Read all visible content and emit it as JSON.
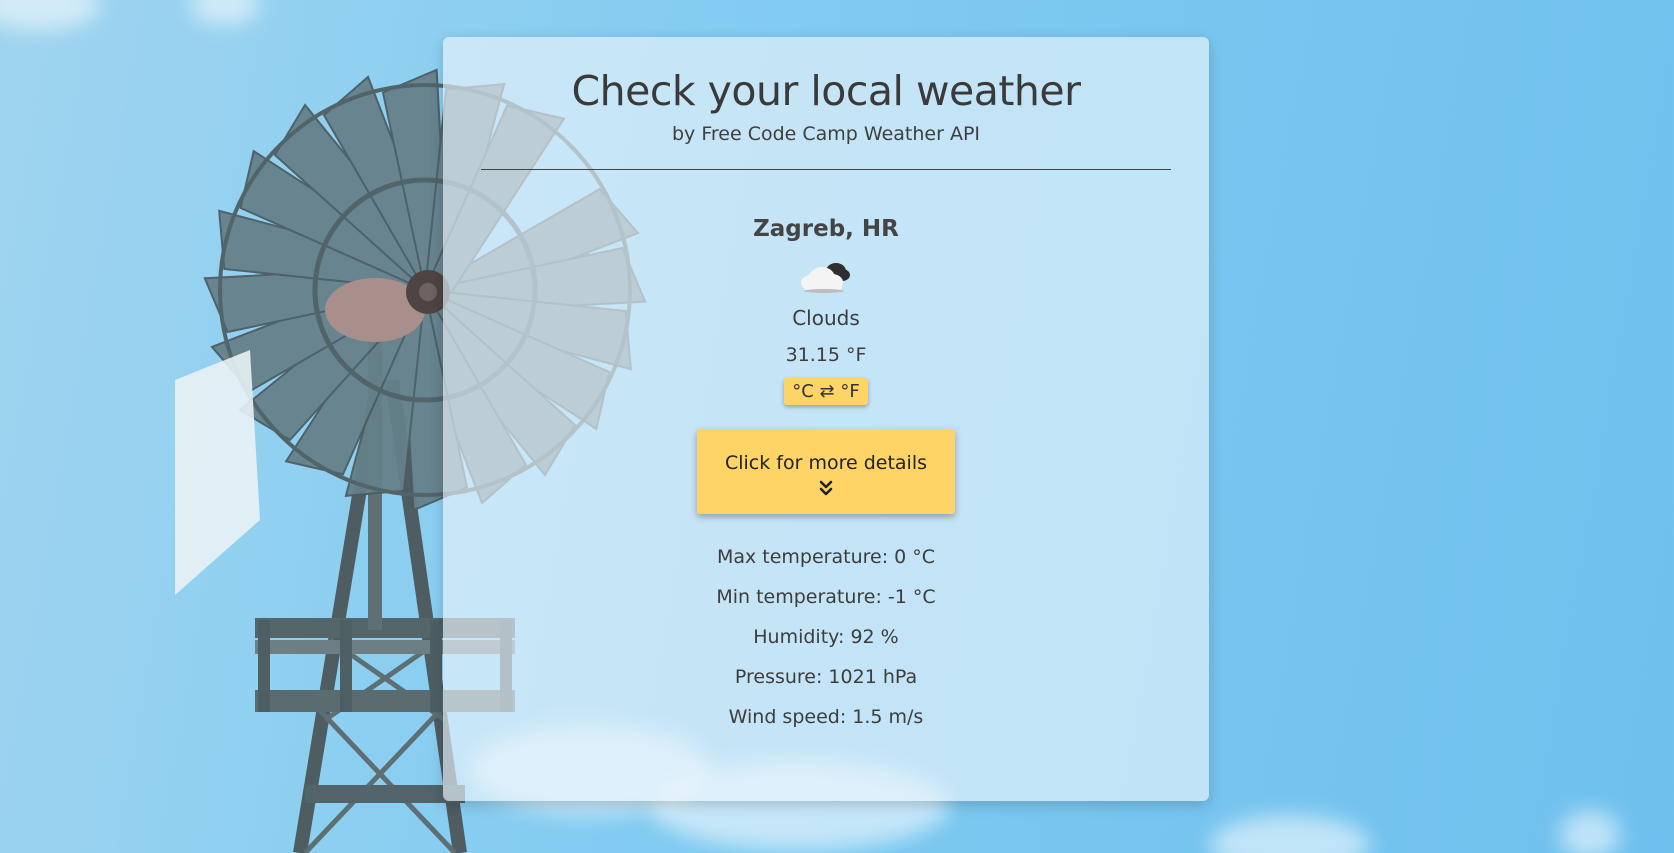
{
  "header": {
    "title": "Check your local weather",
    "subtitle": "by Free Code Camp Weather API"
  },
  "weather": {
    "location": "Zagreb, HR",
    "icon": "cloud-icon",
    "condition": "Clouds",
    "temperature": "31.15 °F",
    "unit_toggle_label": "°C ⇄ °F"
  },
  "details_button": {
    "label": "Click for more details",
    "icon": "double-chevron-down-icon"
  },
  "details": [
    {
      "label": "Max temperature: 0 °C"
    },
    {
      "label": "Min temperature: -1 °C"
    },
    {
      "label": "Humidity: 92 %"
    },
    {
      "label": "Pressure: 1021 hPa"
    },
    {
      "label": "Wind speed: 1.5 m/s"
    }
  ],
  "colors": {
    "accent": "#ffd466",
    "sky": "#7ac7f0",
    "card": "#e8f3fa"
  }
}
